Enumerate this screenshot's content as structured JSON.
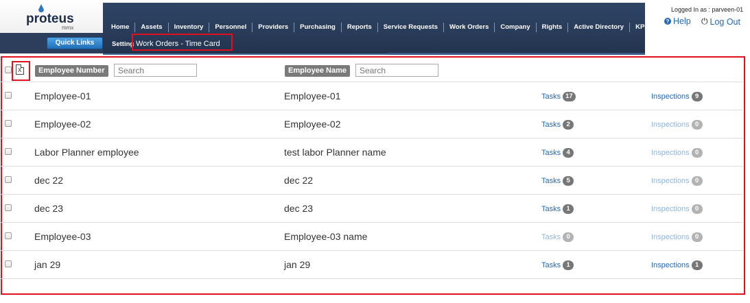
{
  "app": {
    "logo": "proteus",
    "logo_sub": "mmx",
    "quick_links": "Quick Links"
  },
  "menu": [
    {
      "label": "Home"
    },
    {
      "label": "Assets"
    },
    {
      "label": "Inventory"
    },
    {
      "label": "Personnel"
    },
    {
      "label": "Providers"
    },
    {
      "label": "Purchasing"
    },
    {
      "label": "Reports"
    },
    {
      "label": "Service Requests"
    },
    {
      "label": "Work Orders"
    },
    {
      "label": "Company"
    },
    {
      "label": "Rights"
    },
    {
      "label": "Active Directory"
    },
    {
      "label": "KPI"
    }
  ],
  "subnav": {
    "setting": "Setting",
    "breadcrumb": "Work Orders - Time Card"
  },
  "user": {
    "logged_in": "Logged In as : parveen-01",
    "help": "Help",
    "logout": "Log Out"
  },
  "filters": {
    "employee_number_label": "Employee Number",
    "employee_number_placeholder": "Search",
    "employee_name_label": "Employee Name",
    "employee_name_placeholder": "Search"
  },
  "links": {
    "tasks": "Tasks",
    "inspections": "Inspections"
  },
  "rows": [
    {
      "number": "Employee-01",
      "name": "Employee-01",
      "tasks": "17",
      "inspections": "9"
    },
    {
      "number": "Employee-02",
      "name": "Employee-02",
      "tasks": "2",
      "inspections": "0"
    },
    {
      "number": "Labor Planner employee",
      "name": "test labor Planner name",
      "tasks": "4",
      "inspections": "0"
    },
    {
      "number": "dec 22",
      "name": "dec 22",
      "tasks": "5",
      "inspections": "0"
    },
    {
      "number": "dec 23",
      "name": "dec 23",
      "tasks": "1",
      "inspections": "0"
    },
    {
      "number": "Employee-03",
      "name": "Employee-03 name",
      "tasks": "0",
      "inspections": "0"
    },
    {
      "number": "jan 29",
      "name": "jan 29",
      "tasks": "1",
      "inspections": "1"
    }
  ],
  "colors": {
    "accent_red": "#e0101c",
    "link_blue": "#2468b4",
    "nav_dark": "#2f4566"
  }
}
